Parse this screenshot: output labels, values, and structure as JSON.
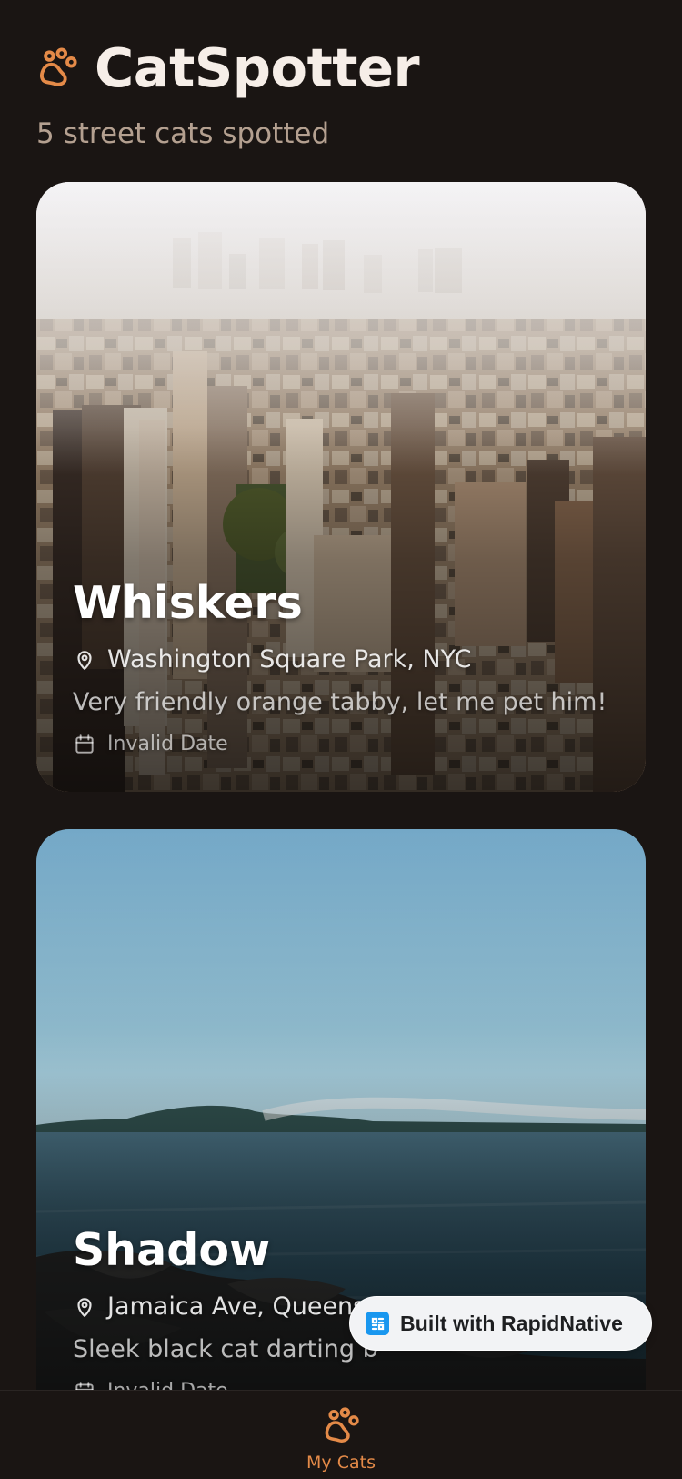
{
  "app": {
    "title": "CatSpotter",
    "subtitle": "5 street cats spotted",
    "accent_color": "#e48a48",
    "brand_icon": "paw-icon"
  },
  "cards": [
    {
      "name": "Whiskers",
      "location": "Washington Square Park, NYC",
      "description": "Very friendly orange tabby, let me pet him!",
      "date": "Invalid Date",
      "image_subject": "aerial city skyline",
      "location_icon": "map-pin-icon",
      "date_icon": "calendar-icon"
    },
    {
      "name": "Shadow",
      "location": "Jamaica Ave, Queens",
      "description": "Sleek black cat darting b",
      "date": "Invalid Date",
      "image_subject": "sea and rocky shoreline",
      "location_icon": "map-pin-icon",
      "date_icon": "calendar-icon"
    }
  ],
  "nav": {
    "tab_label": "My Cats",
    "tab_icon": "paw-icon"
  },
  "badge": {
    "text": "Built with RapidNative",
    "icon": "rapidnative-logo-icon",
    "background": "#f2f3f5",
    "icon_color": "#1997ef"
  }
}
